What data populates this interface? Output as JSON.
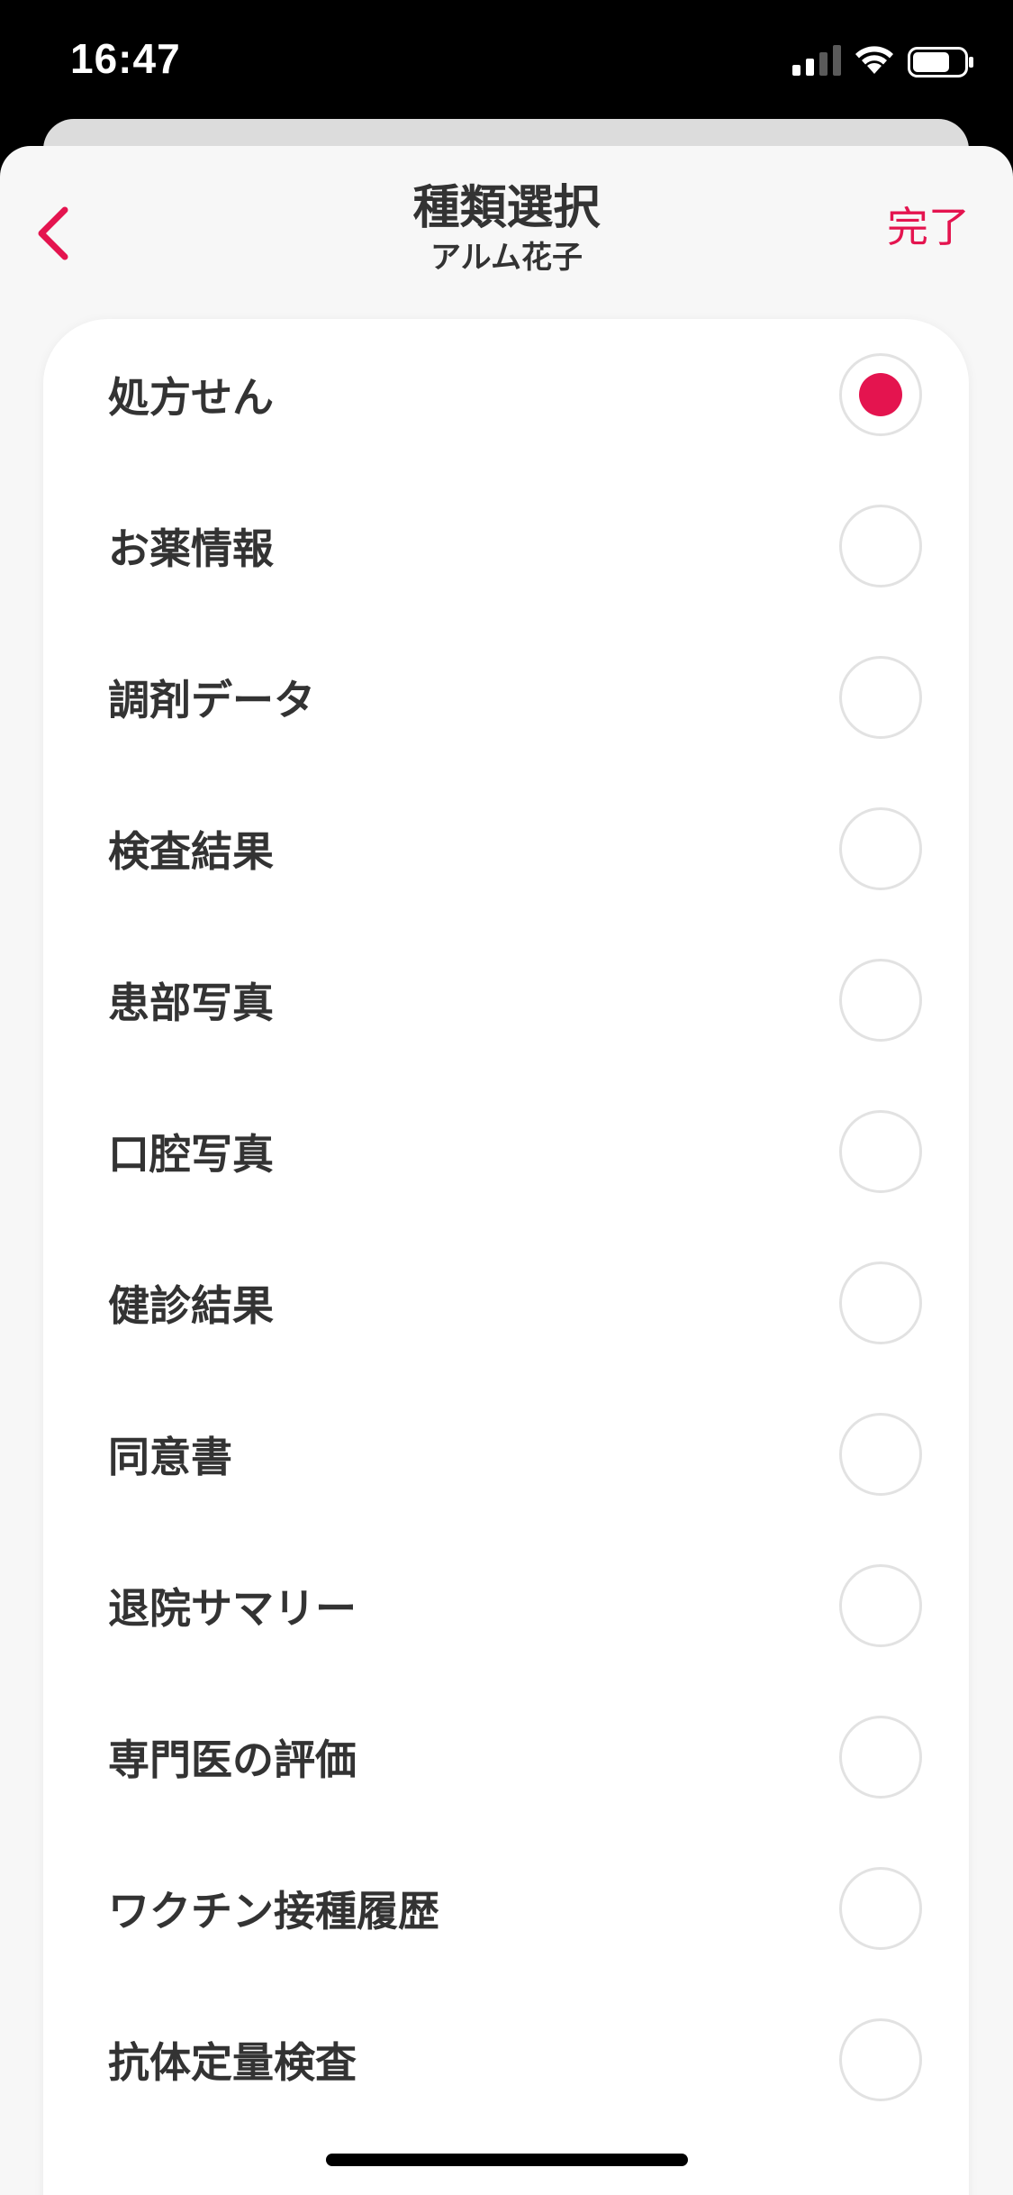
{
  "status_bar": {
    "time": "16:47"
  },
  "nav": {
    "title": "種類選択",
    "subtitle": "アルム花子",
    "done_label": "完了",
    "back_icon": "chevron-left-icon",
    "accent_color": "#e4144f"
  },
  "options": [
    {
      "label": "処方せん",
      "selected": true
    },
    {
      "label": "お薬情報",
      "selected": false
    },
    {
      "label": "調剤データ",
      "selected": false
    },
    {
      "label": "検査結果",
      "selected": false
    },
    {
      "label": "患部写真",
      "selected": false
    },
    {
      "label": "口腔写真",
      "selected": false
    },
    {
      "label": "健診結果",
      "selected": false
    },
    {
      "label": "同意書",
      "selected": false
    },
    {
      "label": "退院サマリー",
      "selected": false
    },
    {
      "label": "専門医の評価",
      "selected": false
    },
    {
      "label": "ワクチン接種履歴",
      "selected": false
    },
    {
      "label": "抗体定量検査",
      "selected": false
    }
  ]
}
